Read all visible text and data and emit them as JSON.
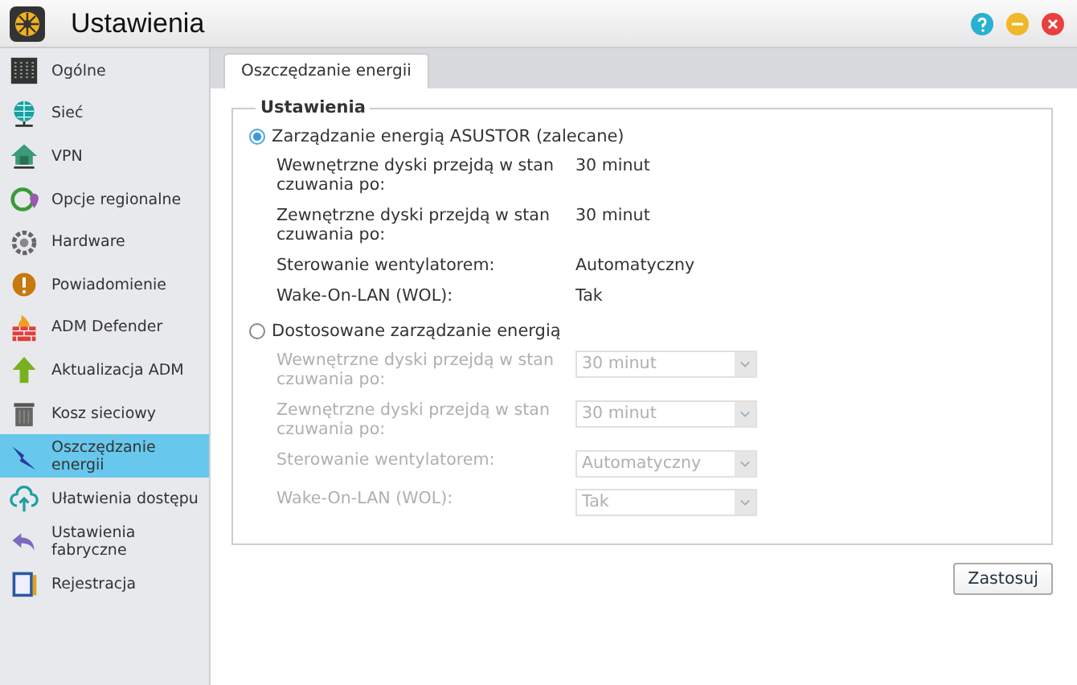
{
  "window": {
    "title": "Ustawienia"
  },
  "sidebar": {
    "items": [
      {
        "label": "Ogólne",
        "selected": false
      },
      {
        "label": "Sieć",
        "selected": false
      },
      {
        "label": "VPN",
        "selected": false
      },
      {
        "label": "Opcje regionalne",
        "selected": false
      },
      {
        "label": "Hardware",
        "selected": false
      },
      {
        "label": "Powiadomienie",
        "selected": false
      },
      {
        "label": "ADM Defender",
        "selected": false
      },
      {
        "label": "Aktualizacja ADM",
        "selected": false
      },
      {
        "label": "Kosz sieciowy",
        "selected": false
      },
      {
        "label": "Oszczędzanie energii",
        "selected": true
      },
      {
        "label": "Ułatwienia dostępu",
        "selected": false
      },
      {
        "label": "Ustawienia fabryczne",
        "selected": false
      },
      {
        "label": "Rejestracja",
        "selected": false
      }
    ]
  },
  "tabs": [
    {
      "label": "Oszczędzanie energii",
      "selected": true
    }
  ],
  "settings": {
    "legend": "Ustawienia",
    "options": [
      {
        "label": "Zarządzanie energią ASUSTOR (zalecane)",
        "selected": true,
        "kind": "readout",
        "disabled": false,
        "rows": [
          {
            "label": "Wewnętrzne dyski przejdą w stan czuwania po:",
            "value": "30 minut"
          },
          {
            "label": "Zewnętrzne dyski przejdą w stan czuwania po:",
            "value": "30 minut"
          },
          {
            "label": "Sterowanie wentylatorem:",
            "value": "Automatyczny"
          },
          {
            "label": "Wake-On-LAN (WOL):",
            "value": "Tak"
          }
        ]
      },
      {
        "label": "Dostosowane zarządzanie energią",
        "selected": false,
        "kind": "select",
        "disabled": true,
        "rows": [
          {
            "label": "Wewnętrzne dyski przejdą w stan czuwania po:",
            "value": "30 minut"
          },
          {
            "label": "Zewnętrzne dyski przejdą w stan czuwania po:",
            "value": "30 minut"
          },
          {
            "label": "Sterowanie wentylatorem:",
            "value": "Automatyczny"
          },
          {
            "label": "Wake-On-LAN (WOL):",
            "value": "Tak"
          }
        ]
      }
    ]
  },
  "buttons": [
    {
      "label": "Zastosuj"
    }
  ]
}
